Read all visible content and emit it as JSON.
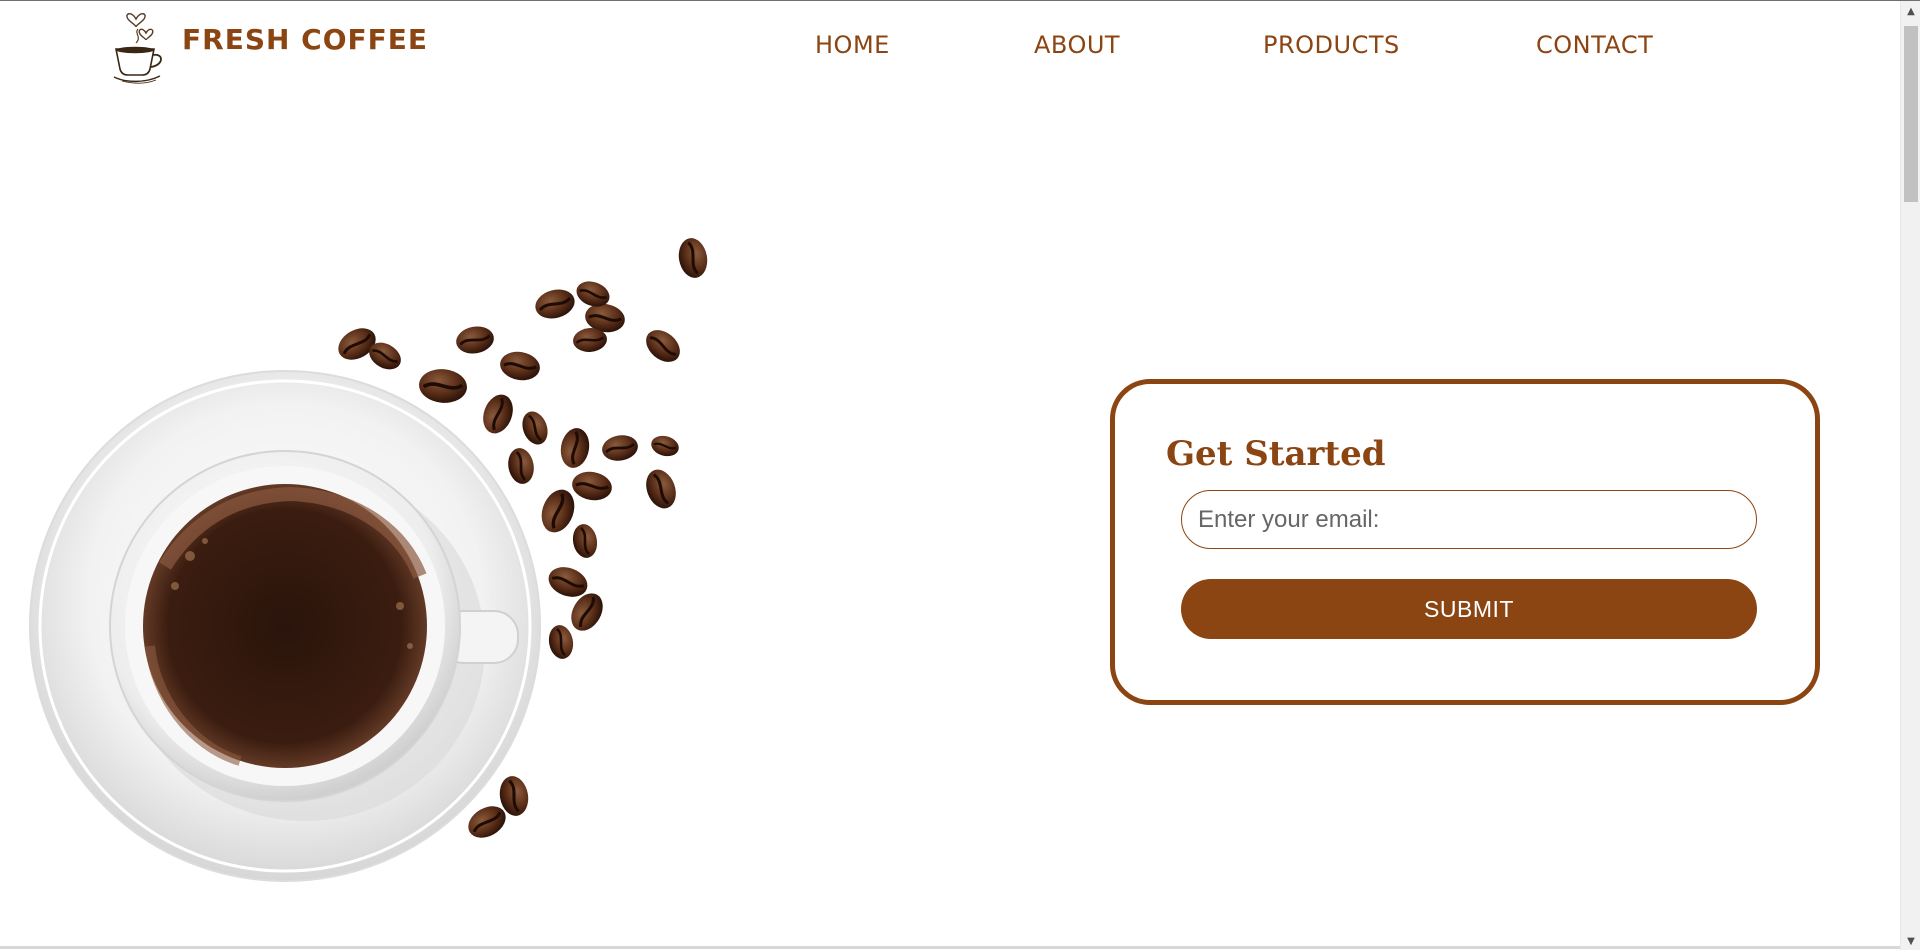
{
  "header": {
    "brand": "FRESH COFFEE",
    "nav": [
      {
        "label": "HOME"
      },
      {
        "label": "ABOUT"
      },
      {
        "label": "PRODUCTS"
      },
      {
        "label": "CONTACT"
      }
    ]
  },
  "hero": {
    "image": "coffee-cup-with-beans"
  },
  "signup": {
    "title": "Get Started",
    "email_placeholder": "Enter your email:",
    "email_value": "",
    "submit_label": "SUBMIT"
  },
  "colors": {
    "brand": "#8b4513",
    "background": "#ffffff",
    "button_text": "#ffffff"
  },
  "icons": {
    "logo": "coffee-cup-hearts-icon",
    "scroll_up": "chevron-up-icon",
    "scroll_down": "chevron-down-icon"
  }
}
